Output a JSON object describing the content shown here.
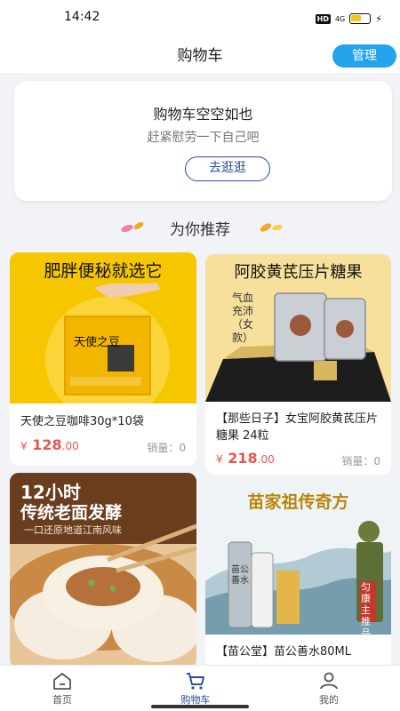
{
  "status_bar": {
    "time": "14:42",
    "hd": "HD",
    "signal": "4G",
    "battery_level": 0.6
  },
  "header": {
    "title": "购物车",
    "manage_label": "管理"
  },
  "empty_cart": {
    "title": "购物车空空如也",
    "subtitle": "赶紧慰劳一下自己吧",
    "button_label": "去逛逛"
  },
  "recommend": {
    "title": "为你推荐"
  },
  "products": [
    {
      "banner": "肥胖便秘就选它",
      "package": "天使之豆",
      "name": "天使之豆咖啡30g*10袋",
      "currency": "¥",
      "price_int": "128",
      "price_dec": ".00",
      "sales": "销量：0"
    },
    {
      "banner": "阿胶黄芪压片糖果",
      "side": "气血充沛（女款）",
      "name": "【那些日子】女宝阿胶黄芪压片糖果 24粒",
      "currency": "¥",
      "price_int": "218",
      "price_dec": ".00",
      "sales": "销量：0"
    },
    {
      "banner1": "12小时",
      "banner2": "传统老面发酵",
      "banner3": "一口还原地道江南风味"
    },
    {
      "banner": "苗家祖传奇方",
      "badge": "匀康主推品",
      "bottle": "苗公善水",
      "name": "【苗公堂】苗公善水80ML"
    }
  ],
  "tabs": [
    {
      "label": "首页",
      "icon": "home-icon"
    },
    {
      "label": "购物车",
      "icon": "cart-icon"
    },
    {
      "label": "我的",
      "icon": "user-icon"
    }
  ],
  "colors": {
    "accent": "#23a3ec",
    "nav_active": "#2b4c9a",
    "price": "#e8554e"
  }
}
